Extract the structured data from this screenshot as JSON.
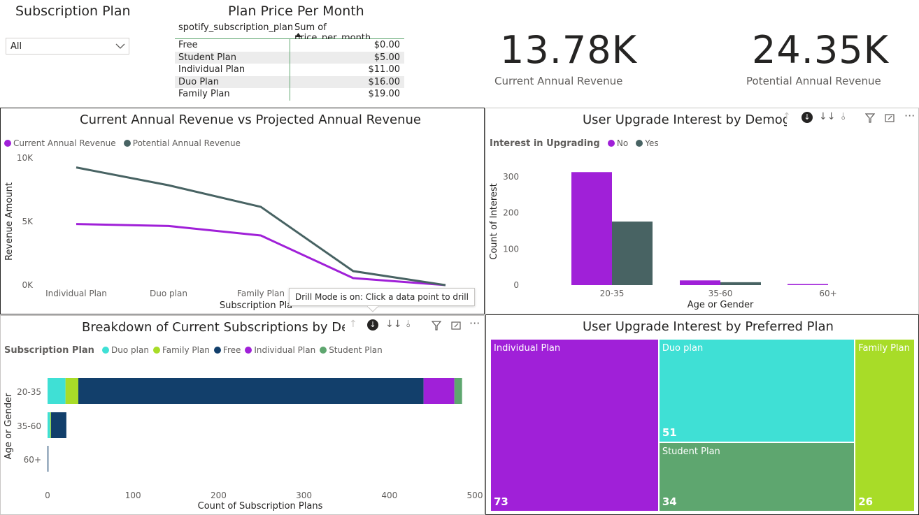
{
  "slicer": {
    "title": "Subscription Plan",
    "value": "All"
  },
  "price_table": {
    "title": "Plan Price Per Month",
    "col1": "spotify_subscription_plan",
    "col2": "Sum of price_per_month",
    "rows": [
      {
        "plan": "Free",
        "price": "$0.00"
      },
      {
        "plan": "Student Plan",
        "price": "$5.00"
      },
      {
        "plan": "Individual Plan",
        "price": "$11.00"
      },
      {
        "plan": "Duo Plan",
        "price": "$16.00"
      },
      {
        "plan": "Family Plan",
        "price": "$19.00"
      }
    ]
  },
  "kpi_current": {
    "value": "13.78K",
    "label": "Current Annual Revenue"
  },
  "kpi_potential": {
    "value": "24.35K",
    "label": "Potential Annual Revenue"
  },
  "tooltip": {
    "text": "Drill Mode is on: Click a data point to drill"
  },
  "colors": {
    "purple": "#a020d8",
    "slate": "#486363",
    "cyan": "#3fe0d5",
    "lime": "#a8dc28",
    "navy": "#123f6b",
    "green": "#5ea66f"
  },
  "chart_data": [
    {
      "type": "line",
      "title": "Current Annual Revenue vs Projected Annual Revenue",
      "xlabel": "Subscription Pla",
      "ylabel": "Revenue Amount",
      "categories": [
        "Individual Plan",
        "Duo plan",
        "Family Plan",
        "",
        ""
      ],
      "y_ticks": [
        "0K",
        "5K",
        "10K"
      ],
      "ylim": [
        0,
        10000
      ],
      "series": [
        {
          "name": "Current Annual Revenue",
          "color": "#a020d8",
          "values": [
            4800,
            4650,
            3900,
            550,
            0
          ]
        },
        {
          "name": "Potential Annual Revenue",
          "color": "#486363",
          "values": [
            9250,
            7850,
            6150,
            1100,
            0
          ]
        }
      ]
    },
    {
      "type": "bar",
      "title": "User Upgrade Interest by Demog",
      "legend_title": "Interest in Upgrading",
      "xlabel": "Age or Gender",
      "ylabel": "Count of Interest",
      "categories": [
        "20-35",
        "35-60",
        "60+"
      ],
      "y_ticks": [
        "0",
        "100",
        "200",
        "300"
      ],
      "ylim": [
        0,
        320
      ],
      "series": [
        {
          "name": "No",
          "color": "#a020d8",
          "values": [
            313,
            13,
            3
          ]
        },
        {
          "name": "Yes",
          "color": "#486363",
          "values": [
            176,
            8,
            0
          ]
        }
      ]
    },
    {
      "type": "bar",
      "orientation": "horizontal-stacked",
      "title": "Breakdown of Current Subscriptions by Dem",
      "legend_title": "Subscription Plan",
      "xlabel": "Count of Subscription Plans",
      "ylabel": "Age or Gender",
      "categories": [
        "20-35",
        "35-60",
        "60+"
      ],
      "x_ticks": [
        "0",
        "100",
        "200",
        "300",
        "400",
        "500"
      ],
      "xlim": [
        0,
        500
      ],
      "series": [
        {
          "name": "Duo plan",
          "color": "#3fe0d5",
          "values": [
            21,
            3,
            0
          ]
        },
        {
          "name": "Family Plan",
          "color": "#a8dc28",
          "values": [
            15,
            1,
            0
          ]
        },
        {
          "name": "Free",
          "color": "#123f6b",
          "values": [
            404,
            18,
            1
          ]
        },
        {
          "name": "Individual Plan",
          "color": "#a020d8",
          "values": [
            36,
            0,
            0
          ]
        },
        {
          "name": "Student Plan",
          "color": "#5ea66f",
          "values": [
            9,
            0,
            0
          ]
        }
      ]
    },
    {
      "type": "treemap",
      "title": "User Upgrade Interest by Preferred Plan",
      "items": [
        {
          "name": "Individual Plan",
          "value": 73,
          "color": "#a020d8"
        },
        {
          "name": "Duo plan",
          "value": 51,
          "color": "#3fe0d5"
        },
        {
          "name": "Student Plan",
          "value": 34,
          "color": "#5ea66f"
        },
        {
          "name": "Family Plan",
          "value": 26,
          "color": "#a8dc28"
        }
      ]
    }
  ]
}
